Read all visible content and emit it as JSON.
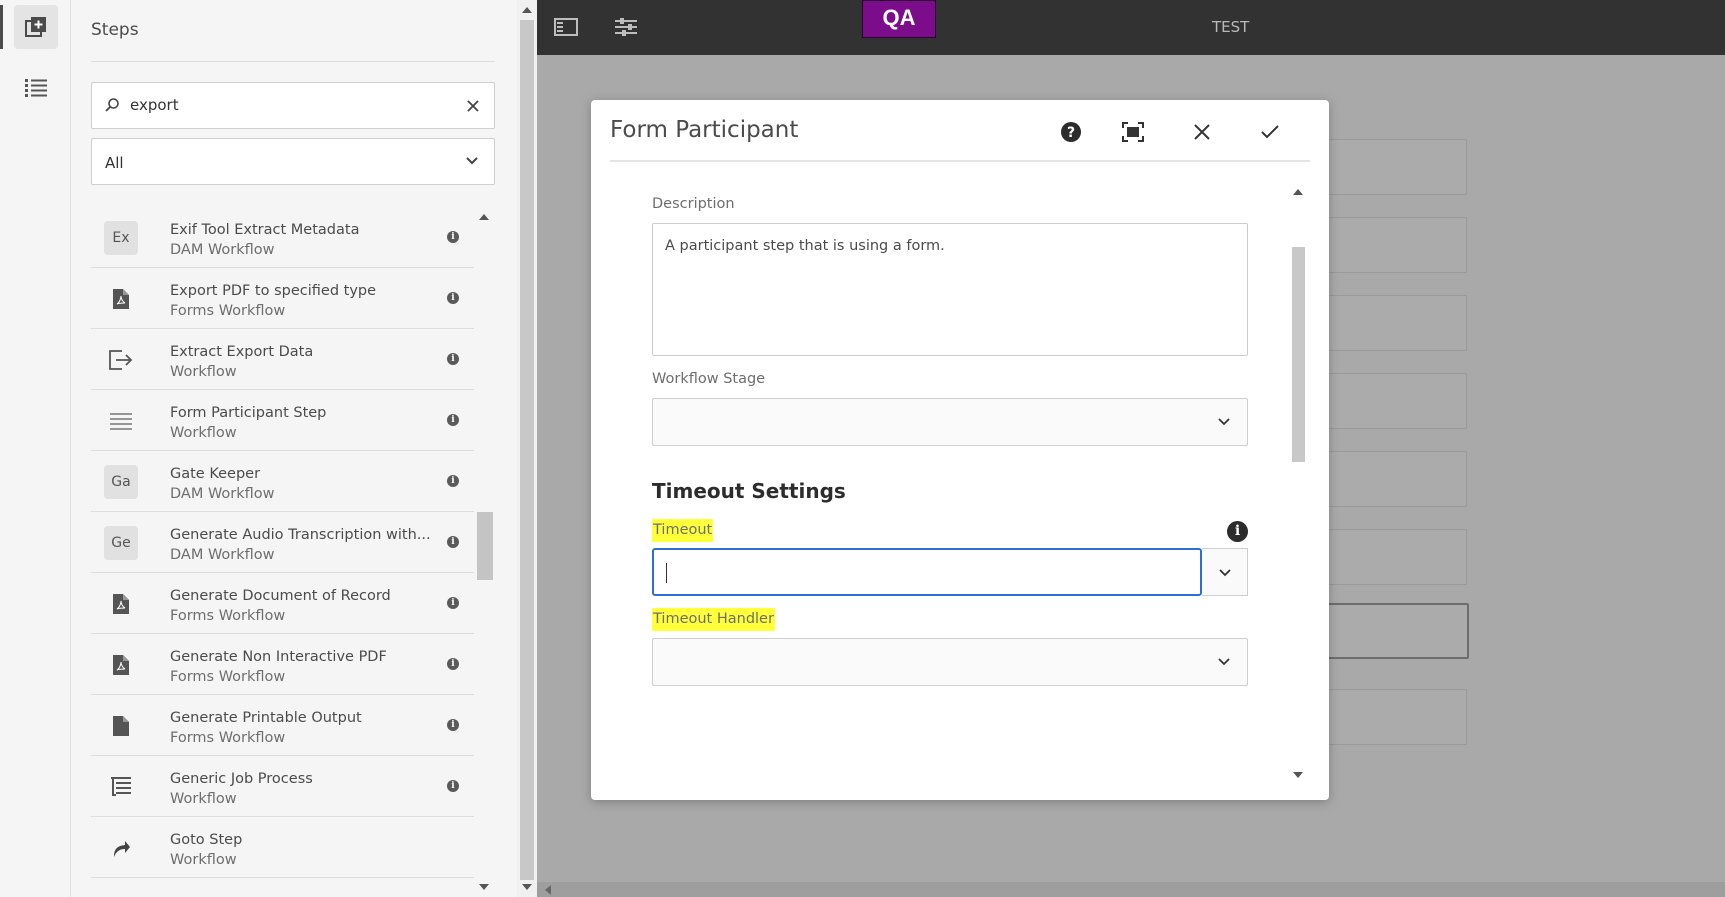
{
  "rail": {
    "items": [
      {
        "icon": "add-step-icon",
        "active": true
      },
      {
        "icon": "list-icon",
        "active": false
      }
    ]
  },
  "panel": {
    "title": "Steps",
    "search": {
      "value": "export"
    },
    "filter": {
      "value": "All"
    },
    "items": [
      {
        "badge": "Ex",
        "icon": "badge",
        "title": "Exif Tool Extract Metadata",
        "subtitle": "DAM Workflow",
        "info": true
      },
      {
        "icon": "pdf-icon",
        "title": "Export PDF to specified type",
        "subtitle": "Forms Workflow",
        "info": true
      },
      {
        "icon": "export-icon",
        "title": "Extract Export Data",
        "subtitle": "Workflow",
        "info": true
      },
      {
        "icon": "lines-icon",
        "title": "Form Participant Step",
        "subtitle": "Workflow",
        "info": true
      },
      {
        "badge": "Ga",
        "icon": "badge",
        "title": "Gate Keeper",
        "subtitle": "DAM Workflow",
        "info": true
      },
      {
        "badge": "Ge",
        "icon": "badge",
        "title": "Generate Audio Transcription with...",
        "subtitle": "DAM Workflow",
        "info": true
      },
      {
        "icon": "pdf-icon",
        "title": "Generate Document of Record",
        "subtitle": "Forms Workflow",
        "info": true
      },
      {
        "icon": "pdf-icon",
        "title": "Generate Non Interactive PDF",
        "subtitle": "Forms Workflow",
        "info": true
      },
      {
        "icon": "document-icon",
        "title": "Generate Printable Output",
        "subtitle": "Forms Workflow",
        "info": true
      },
      {
        "icon": "process-icon",
        "title": "Generic Job Process",
        "subtitle": "Workflow",
        "info": true
      },
      {
        "icon": "goto-icon",
        "title": "Goto Step",
        "subtitle": "Workflow",
        "info": false
      }
    ]
  },
  "topbar": {
    "badge": "QA",
    "badge_color": "#7b0d8a",
    "label": "TEST"
  },
  "dialog": {
    "title": "Form Participant",
    "description_label": "Description",
    "description_value": "A participant step that is using a form.",
    "stage_label": "Workflow Stage",
    "stage_value": "",
    "section_title": "Timeout Settings",
    "timeout_label": "Timeout",
    "timeout_value": "",
    "handler_label": "Timeout Handler",
    "handler_value": "",
    "highlight_color": "#ffff3a"
  }
}
